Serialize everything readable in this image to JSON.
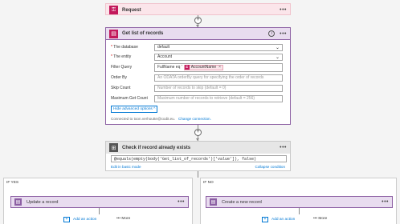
{
  "request": {
    "title": "Request",
    "more": "•••",
    "icon": "request-icon"
  },
  "get_list": {
    "title": "Get list of records",
    "info": "i",
    "more": "•••",
    "fields": {
      "database": {
        "label": "The database",
        "value": "default"
      },
      "entity": {
        "label": "The entity",
        "value": "Account"
      },
      "filter": {
        "label": "Filter Query",
        "value": "FullName eq '",
        "token": "AccountName",
        "token_remove": "×"
      },
      "order_by": {
        "label": "Order By",
        "placeholder": "An ODATA orderBy query for specifying the order of records"
      },
      "skip": {
        "label": "Skip Count",
        "placeholder": "Number of records to skip (default = 0)"
      },
      "max_get": {
        "label": "Maximum Get Count",
        "placeholder": "Maximum number of records to retrieve (default = 256)"
      }
    },
    "hide_advanced": "Hide advanced options ^",
    "connected_text": "Connected to toon.verhoutte@codit.eu.",
    "change_connection": "Change connection."
  },
  "check": {
    "title": "Check if record already exists",
    "more": "•••",
    "expression": "@equals(empty(body('Get_list_of_records')['value']), false)",
    "edit_basic": "Edit in basic mode",
    "collapse": "Collapse condition"
  },
  "if_yes": {
    "label": "IF YES",
    "action_title": "Update a record",
    "add_action": "Add an action",
    "more": "••• More"
  },
  "if_no": {
    "label": "IF NO",
    "action_title": "Create a new record",
    "add_action": "Add an action",
    "more": "••• More"
  },
  "required_mark": "*",
  "plus": "+"
}
